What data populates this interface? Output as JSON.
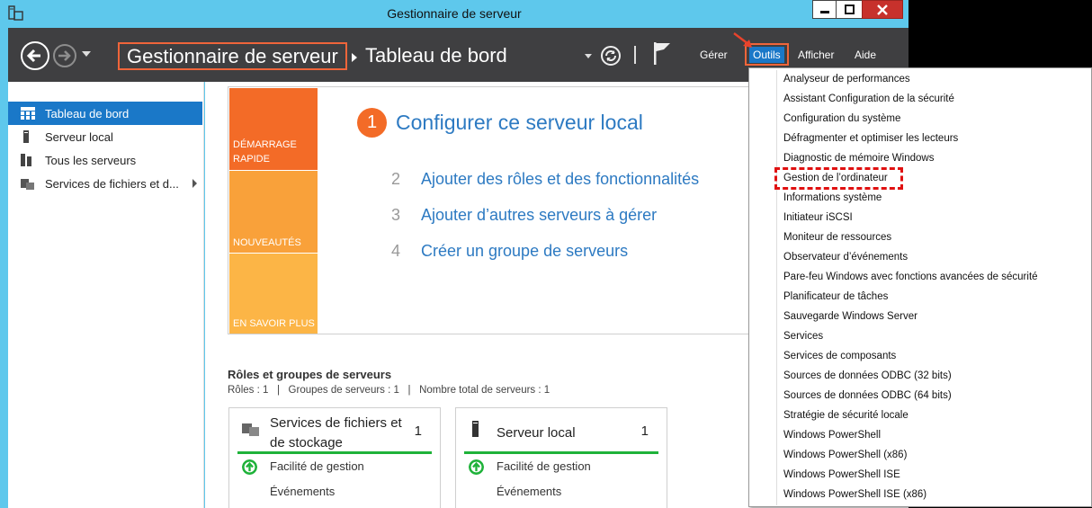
{
  "window": {
    "title": "Gestionnaire de serveur"
  },
  "header": {
    "breadcrumb_root": "Gestionnaire de serveur",
    "breadcrumb_page": "Tableau de bord",
    "menus": {
      "gerer": "Gérer",
      "outils": "Outils",
      "afficher": "Afficher",
      "aide": "Aide"
    }
  },
  "sidebar": {
    "items": [
      {
        "label": "Tableau de bord",
        "icon": "dashboard-icon",
        "selected": true
      },
      {
        "label": "Serveur local",
        "icon": "server-icon"
      },
      {
        "label": "Tous les serveurs",
        "icon": "servers-icon"
      },
      {
        "label": "Services de fichiers et d...",
        "icon": "file-services-icon"
      }
    ]
  },
  "quickstart": {
    "tiles": [
      "DÉMARRAGE RAPIDE",
      "NOUVEAUTÉS",
      "EN SAVOIR PLUS"
    ],
    "steps": [
      {
        "num": "1",
        "label": "Configurer ce serveur local"
      },
      {
        "num": "2",
        "label": "Ajouter des rôles et des fonctionnalités"
      },
      {
        "num": "3",
        "label": "Ajouter d’autres serveurs à gérer"
      },
      {
        "num": "4",
        "label": "Créer un groupe de serveurs"
      }
    ]
  },
  "roles": {
    "title": "Rôles et groupes de serveurs",
    "stats": "Rôles : 1   |   Groupes de serveurs : 1   |   Nombre total de serveurs : 1",
    "cards": [
      {
        "title": "Services de fichiers et de stockage",
        "count": "1",
        "row1": "Facilité de gestion",
        "row2": "Événements"
      },
      {
        "title": "Serveur local",
        "count": "1",
        "row1": "Facilité de gestion",
        "row2": "Événements"
      }
    ]
  },
  "tools_menu": {
    "items": [
      "Analyseur de performances",
      "Assistant Configuration de la sécurité",
      "Configuration du système",
      "Défragmenter et optimiser les lecteurs",
      "Diagnostic de mémoire Windows",
      "Gestion de l’ordinateur",
      "Informations système",
      "Initiateur iSCSI",
      "Moniteur de ressources",
      "Observateur d’événements",
      "Pare-feu Windows avec fonctions avancées de sécurité",
      "Planificateur de tâches",
      "Sauvegarde Windows Server",
      "Services",
      "Services de composants",
      "Sources de données ODBC (32 bits)",
      "Sources de données ODBC (64 bits)",
      "Stratégie de sécurité locale",
      "Windows PowerShell",
      "Windows PowerShell (x86)",
      "Windows PowerShell ISE",
      "Windows PowerShell ISE (x86)"
    ],
    "highlighted_index": 5
  },
  "colors": {
    "accent": "#1a78c8",
    "annotation": "#f0653a",
    "ok": "#1fb23a"
  }
}
